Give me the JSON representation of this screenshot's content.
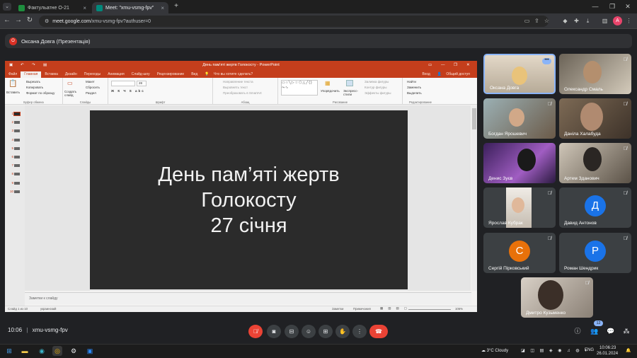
{
  "browser": {
    "tabs": [
      {
        "title": "Фактульатне О-21",
        "active": false
      },
      {
        "title": "Meet: \"xmu-vsmg-fpv\"",
        "active": true
      }
    ],
    "url_host": "meet.google.com",
    "url_path": "/xmu-vsmg-fpv?authuser=0",
    "profile_initial": "A"
  },
  "presenter": {
    "initial": "О",
    "label": "Оксана Довга (Презентація)"
  },
  "powerpoint": {
    "window_title": "День пам'яті жертв Голокосту - PowerPoint",
    "signin": "Вход",
    "share": "Общий доступ",
    "tell_me": "Что вы хотите сделать?",
    "tabs": [
      "Файл",
      "Главная",
      "Вставка",
      "Дизайн",
      "Переходы",
      "Анимация",
      "Слайд-шоу",
      "Рецензирование",
      "Вид"
    ],
    "groups": {
      "clipboard": "Буфер обмена",
      "slides": "Слайды",
      "font": "Шрифт",
      "paragraph": "Абзац",
      "drawing": "Рисование",
      "editing": "Редактирование"
    },
    "ribbon": {
      "paste": "Вставить",
      "cut": "Вырезать",
      "copy": "Копировать",
      "format_painter": "Формат по образцу",
      "new_slide": "Создать слайд",
      "layout": "Макет",
      "reset": "Сбросить",
      "section": "Раздел",
      "text_direction": "Направление текста",
      "align_text": "Выровнять текст",
      "smartart": "Преобразовать в SmartArt",
      "arrange": "Упорядочить",
      "quick_styles": "Экспресс-стили",
      "shape_fill": "Заливка фигуры",
      "shape_outline": "Контур фигуры",
      "shape_effects": "Эффекты фигуры",
      "find": "Найти",
      "replace": "Заменить",
      "select": "Выделить",
      "font_size": "28"
    },
    "slide_numbers": [
      "1",
      "2",
      "3",
      "4",
      "5",
      "6",
      "7",
      "8",
      "9",
      "10"
    ],
    "slide_text": [
      "День пам’яті жертв",
      "Голокосту",
      "27 січня"
    ],
    "notes_placeholder": "Заметки к слайду",
    "status_slide": "Слайд 1 из 10",
    "status_lang": "украинский",
    "status_notes": "Заметки",
    "status_comments": "Примечания",
    "zoom": "106%"
  },
  "participants": [
    {
      "name": "Оксана Довга",
      "type": "video"
    },
    {
      "name": "Олександр Смаль",
      "type": "video"
    },
    {
      "name": "Богдан Ярошевич",
      "type": "video"
    },
    {
      "name": "Даніла Халабуда",
      "type": "video"
    },
    {
      "name": "Денис Зуєв",
      "type": "video"
    },
    {
      "name": "Артем Зданович",
      "type": "video"
    },
    {
      "name": "Ярослав Кубрак",
      "type": "video"
    },
    {
      "name": "Давид Антонов",
      "type": "avatar",
      "initial": "Д",
      "color": "#1a73e8"
    },
    {
      "name": "Сергій Пірковський",
      "type": "avatar",
      "initial": "С",
      "color": "#e8710a"
    },
    {
      "name": "Роман Шендрик",
      "type": "avatar",
      "initial": "Р",
      "color": "#1a73e8"
    },
    {
      "name": "Дмитро Кузьменко",
      "type": "video"
    }
  ],
  "meeting": {
    "time": "10:06",
    "separator": "|",
    "code": "xmu-vsmg-fpv",
    "participant_count": "12"
  },
  "taskbar": {
    "temperature": "3°C",
    "weather": "Cloudy",
    "lang": "ENG",
    "time": "10:06:23",
    "date": "26.01.2024"
  },
  "colors": {
    "ppt_accent": "#c43e1c",
    "end_call": "#ea4335",
    "meet_bg": "#202124"
  }
}
